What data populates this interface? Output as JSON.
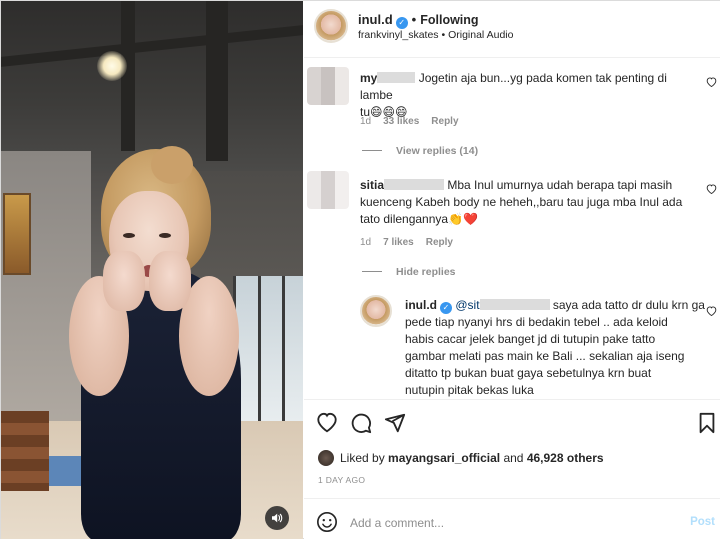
{
  "post": {
    "username": "inul.d",
    "verified": true,
    "separator": "•",
    "follow_state": "Following",
    "subtitle_user": "frankvinyl_skates",
    "subtitle_sep": "•",
    "subtitle_audio": "Original Audio"
  },
  "comments": [
    {
      "username_visible": "my",
      "text_line1": "Jogetin aja bun...yg pada komen tak penting di lambe",
      "text_line2": "tu😄😄😄",
      "time": "1d",
      "likes": "33 likes",
      "reply_label": "Reply",
      "thread_toggle": "View replies (14)"
    },
    {
      "username_visible": "sitia",
      "text_line1": "Mba Inul umurnya udah berapa tapi masih",
      "text_line2": "kuenceng Kabeh body ne heheh,,baru tau juga mba Inul ada",
      "text_line3": "tato dilengannya👏❤️",
      "time": "1d",
      "likes": "7 likes",
      "reply_label": "Reply",
      "thread_toggle": "Hide replies"
    }
  ],
  "reply": {
    "username": "inul.d",
    "mention_visible": "@sit",
    "text_line1": "saya ada tatto dr dulu krn ga",
    "text_line2": "pede tiap nyanyi hrs di bedakin tebel .. ada keloid",
    "text_line3": "habis cacar jelek banget jd di tutupin pake tatto",
    "text_line4": "gambar melati pas main ke Bali ... sekalian aja iseng",
    "text_line5": "ditatto tp bukan buat gaya sebetulnya krn buat",
    "text_line6": "nutupin pitak bekas luka"
  },
  "likes_line": {
    "prefix": "Liked by",
    "user": "mayangsari_official",
    "mid": "and",
    "count": "46,928 others"
  },
  "timestamp": "1 DAY AGO",
  "add_comment": {
    "placeholder": "Add a comment...",
    "post_label": "Post"
  },
  "icons": {
    "like": "heart-icon",
    "comment": "comment-icon",
    "share": "send-icon",
    "save": "bookmark-icon",
    "emoji": "smile-icon",
    "sound": "speaker-icon"
  },
  "colors": {
    "verified": "#3897f0",
    "muted_text": "#8e8e8e",
    "post_button_disabled": "#b2dffc",
    "reaction_heart": "#ed4956"
  }
}
